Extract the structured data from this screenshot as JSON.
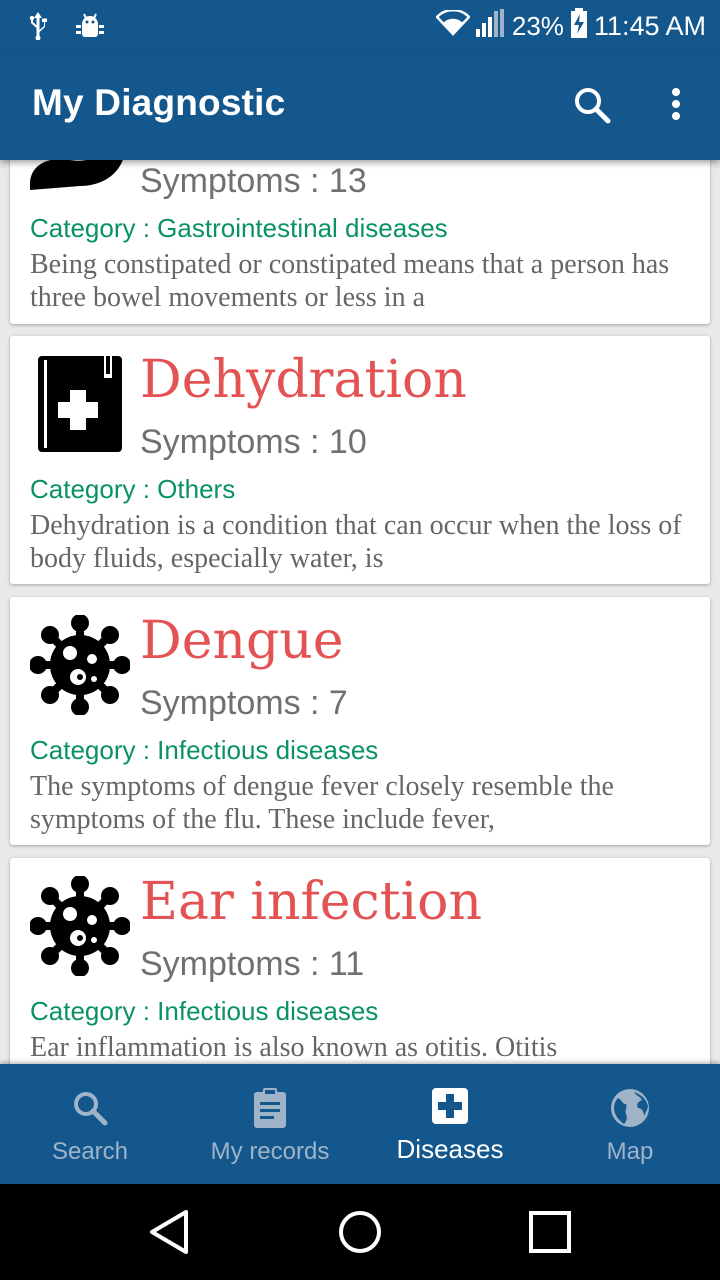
{
  "status_bar": {
    "icons": [
      "usb-icon",
      "android-debug-icon",
      "wifi-icon",
      "signal-icon",
      "battery-charging-icon"
    ],
    "battery_percent": "23%",
    "time": "11:45 AM"
  },
  "app_bar": {
    "title": "My Diagnostic",
    "actions": [
      "search-icon",
      "more-vert-icon"
    ]
  },
  "diseases": [
    {
      "name": "",
      "icon": "stomach-icon",
      "symptoms": "Symptoms : 13",
      "category": "Category : Gastrointestinal diseases",
      "description": "Being constipated or constipated means that a person has three bowel movements or less in a"
    },
    {
      "name": "Dehydration",
      "icon": "medical-book-icon",
      "symptoms": "Symptoms : 10",
      "category": "Category : Others",
      "description": "Dehydration is a condition that can occur when the loss of body fluids, especially water, is"
    },
    {
      "name": "Dengue",
      "icon": "virus-icon",
      "symptoms": "Symptoms : 7",
      "category": "Category : Infectious diseases",
      "description": "The symptoms of dengue fever closely resemble the symptoms of the flu. These include fever,"
    },
    {
      "name": "Ear infection",
      "icon": "virus-icon",
      "symptoms": "Symptoms : 11",
      "category": "Category : Infectious diseases",
      "description": "Ear inflammation is also known as otitis. Otitis"
    }
  ],
  "bottom_nav": [
    {
      "label": "Search",
      "icon": "search-icon",
      "active": false
    },
    {
      "label": "My records",
      "icon": "clipboard-icon",
      "active": false
    },
    {
      "label": "Diseases",
      "icon": "medical-plus-icon",
      "active": true
    },
    {
      "label": "Map",
      "icon": "globe-icon",
      "active": false
    }
  ],
  "system_nav": [
    "back-icon",
    "home-icon",
    "recents-icon"
  ],
  "colors": {
    "primary": "#14578d",
    "disease_name": "#e35353",
    "category": "#0a9263",
    "inactive_nav": "#9fb4c8"
  }
}
